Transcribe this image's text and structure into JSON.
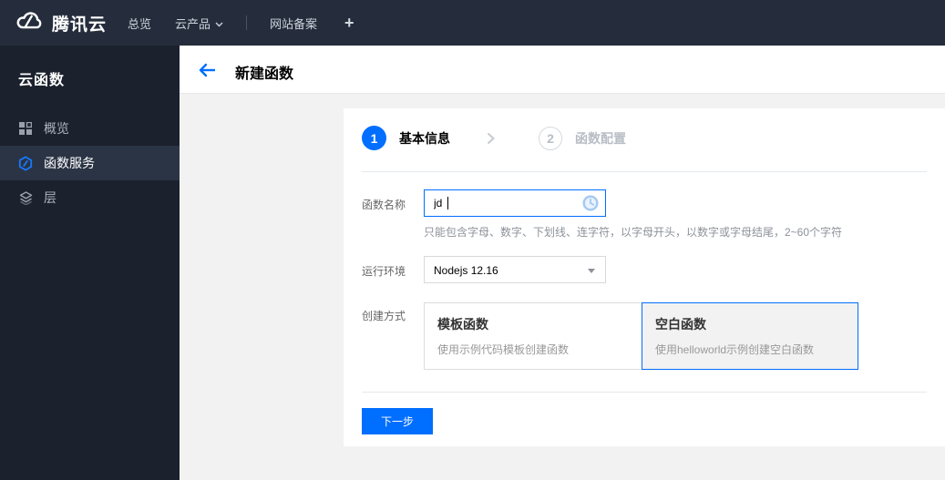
{
  "colors": {
    "accent": "#006eff",
    "topbar_bg": "#252d3c",
    "sidebar_bg": "#1b212d",
    "sidebar_active_bg": "#2b3444",
    "content_bg": "#f2f2f2"
  },
  "topbar": {
    "brand": "腾讯云",
    "items": [
      {
        "label": "总览"
      },
      {
        "label": "云产品"
      },
      {
        "label": "网站备案"
      },
      {
        "label": "+"
      }
    ]
  },
  "sidebar": {
    "title": "云函数",
    "items": [
      {
        "label": "概览",
        "icon": "grid-icon",
        "active": false
      },
      {
        "label": "函数服务",
        "icon": "scf-hexagon-icon",
        "active": true
      },
      {
        "label": "层",
        "icon": "layers-icon",
        "active": false
      }
    ]
  },
  "header": {
    "title": "新建函数"
  },
  "wizard": {
    "steps": [
      {
        "num": "1",
        "label": "基本信息",
        "state": "current"
      },
      {
        "num": "2",
        "label": "函数配置",
        "state": "pending"
      }
    ],
    "form": {
      "name": {
        "label": "函数名称",
        "value": "jd",
        "hint": "只能包含字母、数字、下划线、连字符，以字母开头，以数字或字母结尾，2~60个字符"
      },
      "runtime": {
        "label": "运行环境",
        "value": "Nodejs 12.16"
      },
      "method": {
        "label": "创建方式",
        "options": [
          {
            "title": "模板函数",
            "desc": "使用示例代码模板创建函数",
            "selected": false
          },
          {
            "title": "空白函数",
            "desc": "使用helloworld示例创建空白函数",
            "selected": true
          }
        ]
      }
    },
    "next_label": "下一步"
  }
}
